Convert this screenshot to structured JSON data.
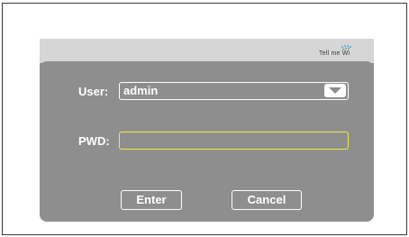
{
  "brand": {
    "logo_text": "Tell me Wi"
  },
  "login_form": {
    "user_label": "User:",
    "user_value": "admin",
    "pwd_label": "PWD:",
    "pwd_value": "",
    "enter_label": "Enter",
    "cancel_label": "Cancel"
  },
  "icons": {
    "dropdown": "chevron-down-icon",
    "logo": "wifi-dots-icon"
  },
  "colors": {
    "panel": "#8e8e8e",
    "header": "#d6d6d6",
    "focus_border": "#f2ea3b",
    "text": "#ffffff"
  }
}
